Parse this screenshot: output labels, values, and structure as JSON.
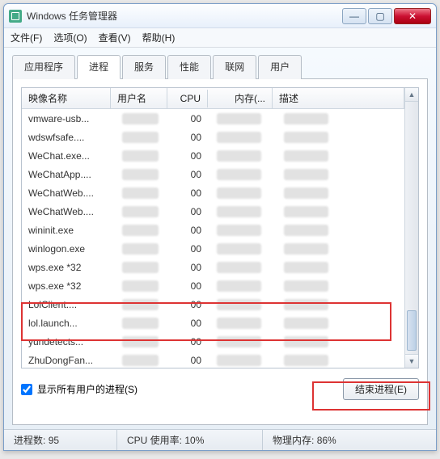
{
  "window": {
    "title": "Windows 任务管理器"
  },
  "menu": {
    "file": "文件(F)",
    "options": "选项(O)",
    "view": "查看(V)",
    "help": "帮助(H)"
  },
  "tabs": {
    "apps": "应用程序",
    "processes": "进程",
    "services": "服务",
    "performance": "性能",
    "networking": "联网",
    "users": "用户"
  },
  "columns": {
    "image": "映像名称",
    "user": "用户名",
    "cpu": "CPU",
    "memory": "内存(...",
    "desc": "描述"
  },
  "rows": [
    {
      "img": "vmware-usb...",
      "cpu": "00"
    },
    {
      "img": "wdswfsafe....",
      "cpu": "00"
    },
    {
      "img": "WeChat.exe...",
      "cpu": "00"
    },
    {
      "img": "WeChatApp....",
      "cpu": "00"
    },
    {
      "img": "WeChatWeb....",
      "cpu": "00"
    },
    {
      "img": "WeChatWeb....",
      "cpu": "00"
    },
    {
      "img": "wininit.exe",
      "cpu": "00"
    },
    {
      "img": "winlogon.exe",
      "cpu": "00"
    },
    {
      "img": "wps.exe *32",
      "cpu": "00"
    },
    {
      "img": "wps.exe *32",
      "cpu": "00"
    },
    {
      "img": "LolClient....",
      "cpu": "00"
    },
    {
      "img": "lol.launch...",
      "cpu": "00"
    },
    {
      "img": "yundetects...",
      "cpu": "00"
    },
    {
      "img": "ZhuDongFan...",
      "cpu": "00"
    }
  ],
  "checkbox": {
    "label": "显示所有用户的进程(S)"
  },
  "buttons": {
    "end": "结束进程(E)"
  },
  "status": {
    "procs_label": "进程数:",
    "procs_val": "95",
    "cpu_label": "CPU 使用率:",
    "cpu_val": "10%",
    "mem_label": "物理内存:",
    "mem_val": "86%"
  }
}
